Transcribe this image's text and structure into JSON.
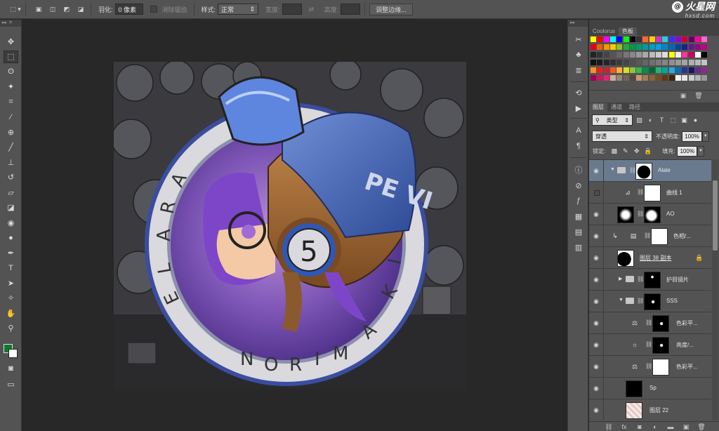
{
  "options_bar": {
    "feather_label": "羽化:",
    "feather_value": "0 像素",
    "antialias_label": "消除锯齿",
    "style_label": "样式:",
    "style_value": "正常",
    "width_label": "宽度:",
    "height_label": "高度:",
    "refine_edge_button": "调整边缘..."
  },
  "logo": {
    "main": "火星网",
    "sub": "hxsd.com",
    "mark": "@"
  },
  "artwork": {
    "badge_number": "5",
    "helmet_text": "PE VI",
    "ring_text": "ARALE NORIMAKI",
    "badge_letters": [
      "A",
      "R",
      "A",
      "L",
      "E",
      "N",
      "O",
      "R",
      "I",
      "M",
      "A",
      "K",
      "I"
    ]
  },
  "swatches_panel": {
    "tabs": [
      "Coolorus",
      "色板"
    ],
    "active_tab": "色板",
    "colors": [
      "#ffff00",
      "#ff0000",
      "#ff00ff",
      "#00ffff",
      "#0000ff",
      "#00ff00",
      "#000000",
      "#333333",
      "#ff6633",
      "#ffcc00",
      "#cc33cc",
      "#33cccc",
      "#3333ff",
      "#9900cc",
      "#cc0033",
      "#660066",
      "#ff0099",
      "#ff66cc",
      "#e60012",
      "#eb6100",
      "#f39800",
      "#fcc800",
      "#8fc31f",
      "#22ac38",
      "#009944",
      "#009b6b",
      "#009e96",
      "#00a0c1",
      "#00a0e9",
      "#0086d1",
      "#0068b7",
      "#00479d",
      "#1d2088",
      "#601986",
      "#920783",
      "#be0081",
      "#222222",
      "#333333",
      "#444444",
      "#555555",
      "#666666",
      "#777777",
      "#888888",
      "#999999",
      "#aaaaaa",
      "#bbbbbb",
      "#cccccc",
      "#dddddd",
      "#ffff00",
      "#eeeeee",
      "#ff3399",
      "#cc0066",
      "#ffffff",
      "#000000",
      "#111111",
      "#1a1a1a",
      "#262626",
      "#303030",
      "#3b3b3b",
      "#454545",
      "#505050",
      "#5a5a5a",
      "#656565",
      "#707070",
      "#7a7a7a",
      "#858585",
      "#8f8f8f",
      "#9a9a9a",
      "#a4a4a4",
      "#afafaf",
      "#b9b9b9",
      "#c4c4c4",
      "#f7941d",
      "#ed1c24",
      "#c1272d",
      "#f15a24",
      "#fbb03b",
      "#d9e021",
      "#8cc63f",
      "#39b54a",
      "#009245",
      "#006837",
      "#22b573",
      "#00a99d",
      "#29abe2",
      "#0071bc",
      "#2e3192",
      "#1b1464",
      "#662d91",
      "#93278f",
      "#9e005d",
      "#d4145a",
      "#ed1e79",
      "#c7b299",
      "#998675",
      "#736357",
      "#534741",
      "#c69c6d",
      "#a67c52",
      "#8c6239",
      "#754c24",
      "#603813",
      "#42210b",
      "#f2f2f2",
      "#e6e6e6",
      "#cccccc",
      "#b3b3b3",
      "#999999"
    ]
  },
  "layers_panel": {
    "tabs": [
      "图层",
      "通道",
      "路径"
    ],
    "active_tab": "图层",
    "filter_label": "类型",
    "blend_mode": "穿透",
    "opacity_label": "不透明度:",
    "opacity_value": "100%",
    "lock_label": "锁定:",
    "fill_label": "填充:",
    "fill_value": "100%",
    "layers": [
      {
        "name": "Alale",
        "kind": "group-mask",
        "visible": true,
        "selected": true
      },
      {
        "name": "曲线 1",
        "kind": "curves",
        "visible": false,
        "selected": false
      },
      {
        "name": "AO",
        "kind": "mask-pair",
        "visible": true,
        "selected": false
      },
      {
        "name": "色相/...",
        "kind": "hue",
        "visible": true,
        "selected": false
      },
      {
        "name": "图层 38 副本",
        "kind": "pixel",
        "visible": true,
        "selected": false
      },
      {
        "name": "护目镜片",
        "kind": "group-collapsed",
        "visible": true,
        "selected": false
      },
      {
        "name": "SSS",
        "kind": "group-open",
        "visible": true,
        "selected": false
      },
      {
        "name": "色彩平...",
        "kind": "balance",
        "visible": true,
        "selected": false
      },
      {
        "name": "亮度/...",
        "kind": "brightness",
        "visible": true,
        "selected": false
      },
      {
        "name": "色彩平...",
        "kind": "balance2",
        "visible": true,
        "selected": false
      },
      {
        "name": "Sp",
        "kind": "pixel-dark",
        "visible": true,
        "selected": false
      },
      {
        "name": "图层 22",
        "kind": "pixel-art",
        "visible": true,
        "selected": false
      }
    ]
  },
  "toolbar": {
    "tools": [
      {
        "name": "move-tool",
        "glyph": "✥"
      },
      {
        "name": "marquee-tool",
        "glyph": "⬚"
      },
      {
        "name": "lasso-tool",
        "glyph": "ʘ"
      },
      {
        "name": "magic-wand-tool",
        "glyph": "✦"
      },
      {
        "name": "crop-tool",
        "glyph": "⌗"
      },
      {
        "name": "eyedropper-tool",
        "glyph": "⁄"
      },
      {
        "name": "healing-tool",
        "glyph": "⊕"
      },
      {
        "name": "brush-tool",
        "glyph": "╱"
      },
      {
        "name": "stamp-tool",
        "glyph": "⊥"
      },
      {
        "name": "history-brush-tool",
        "glyph": "↺"
      },
      {
        "name": "eraser-tool",
        "glyph": "▱"
      },
      {
        "name": "bucket-tool",
        "glyph": "◪"
      },
      {
        "name": "blur-tool",
        "glyph": "◉"
      },
      {
        "name": "dodge-tool",
        "glyph": "●"
      },
      {
        "name": "pen-tool",
        "glyph": "✒"
      },
      {
        "name": "type-tool",
        "glyph": "T"
      },
      {
        "name": "path-select-tool",
        "glyph": "➤"
      },
      {
        "name": "shape-tool",
        "glyph": "✧"
      },
      {
        "name": "hand-tool",
        "glyph": "✋"
      },
      {
        "name": "zoom-tool",
        "glyph": "⚲"
      }
    ]
  }
}
